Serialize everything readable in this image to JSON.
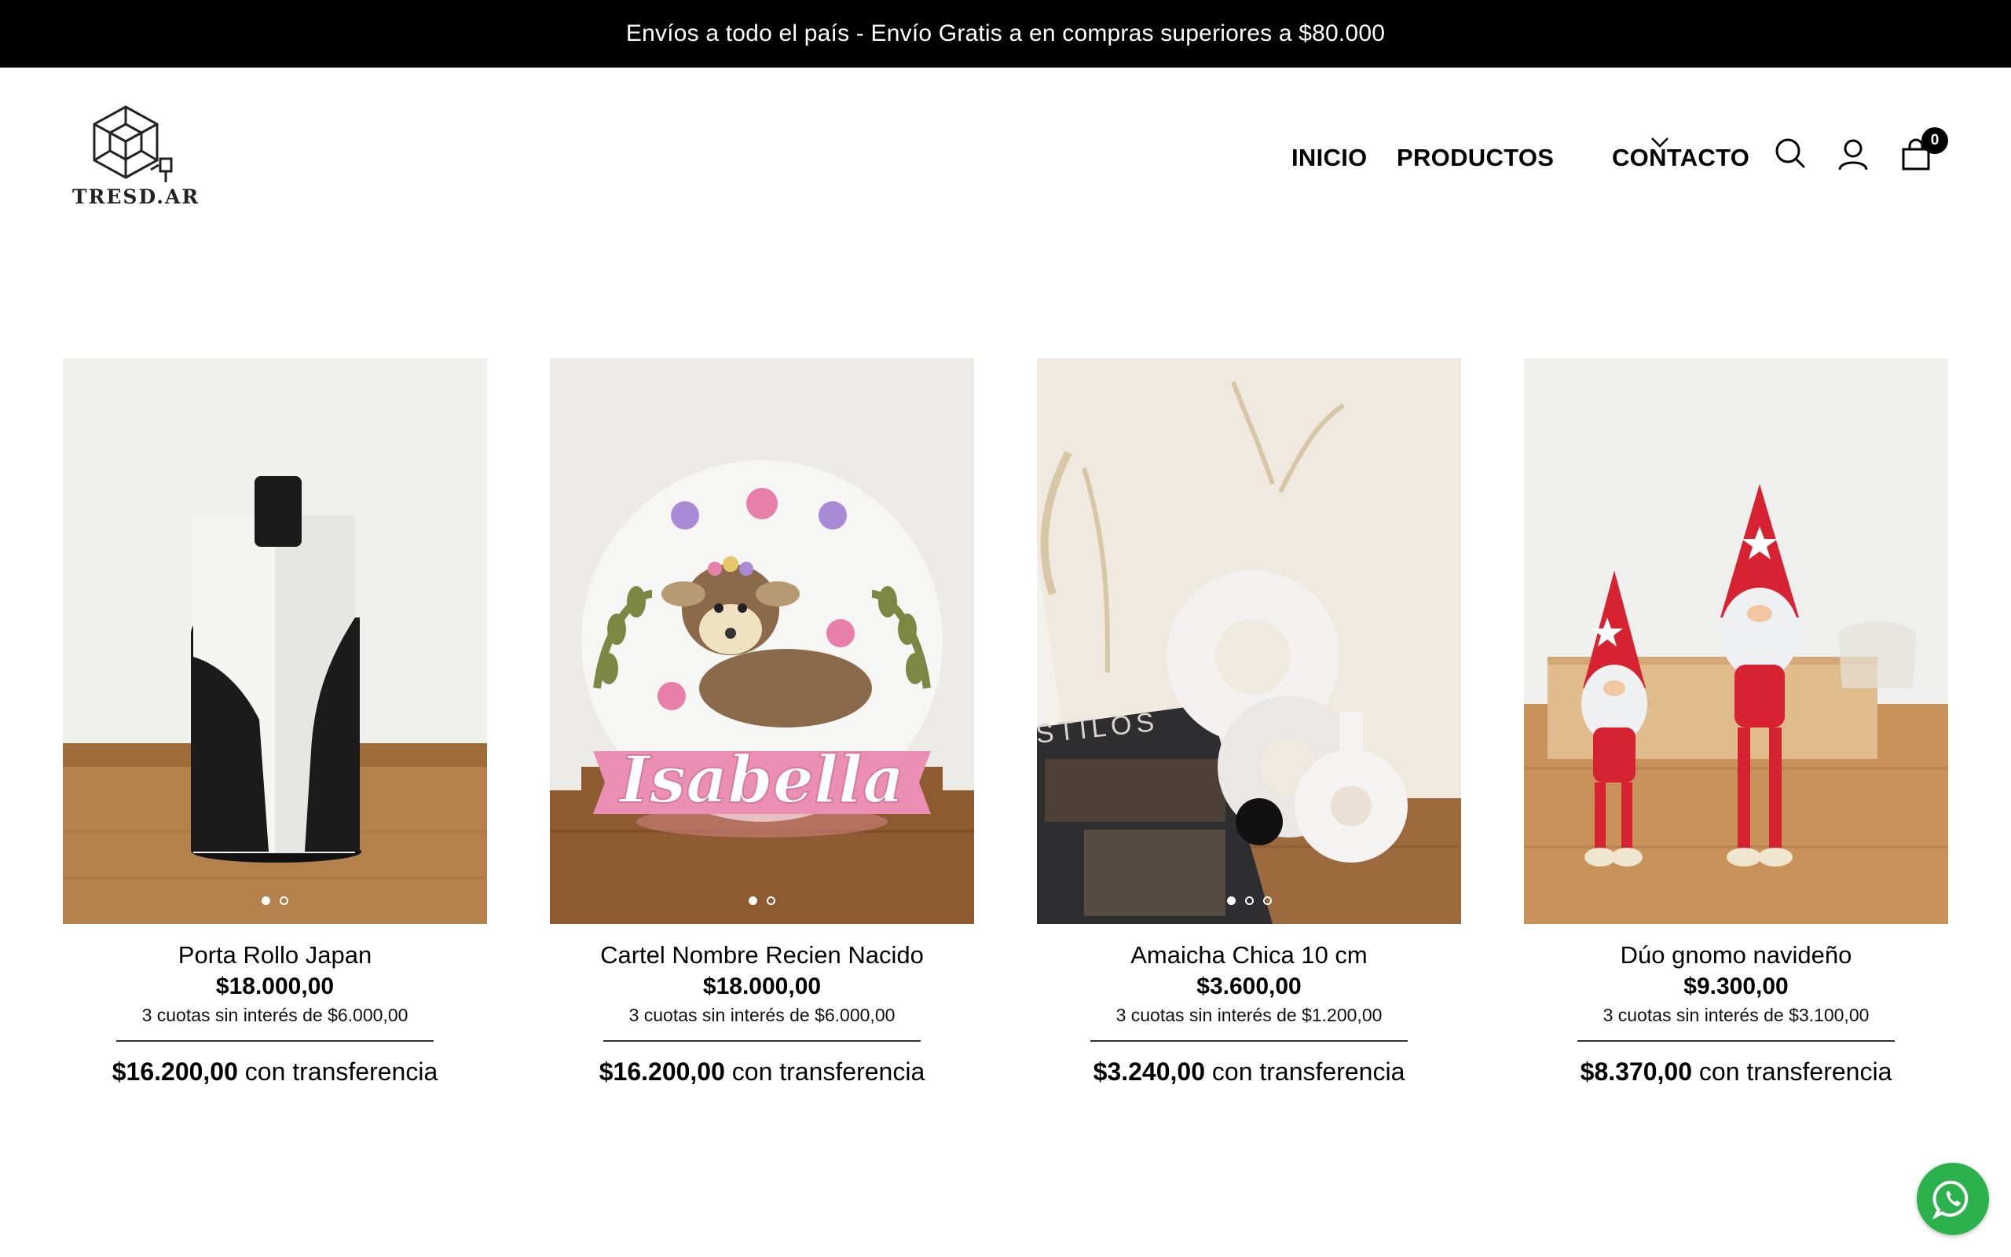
{
  "announcement": "Envíos a todo el país - Envío Gratis a en compras superiores a $80.000",
  "brand": {
    "logo_text": "TRESD.AR"
  },
  "nav": {
    "inicio": "INICIO",
    "productos": "PRODUCTOS",
    "contacto": "CONTACTO"
  },
  "cart": {
    "count": "0"
  },
  "products": [
    {
      "name": "Porta Rollo Japan",
      "price": "$18.000,00",
      "installments": "3 cuotas sin interés de $6.000,00",
      "transfer_price": "$16.200,00",
      "transfer_label": "con transferencia"
    },
    {
      "name": "Cartel Nombre Recien Nacido",
      "price": "$18.000,00",
      "installments": "3 cuotas sin interés de $6.000,00",
      "transfer_price": "$16.200,00",
      "transfer_label": "con transferencia",
      "image_text": "Isabella"
    },
    {
      "name": "Amaicha Chica 10 cm",
      "price": "$3.600,00",
      "installments": "3 cuotas sin interés de $1.200,00",
      "transfer_price": "$3.240,00",
      "transfer_label": "con transferencia",
      "image_text": "STILOS"
    },
    {
      "name": "Dúo gnomo navideño",
      "price": "$9.300,00",
      "installments": "3 cuotas sin interés de $3.100,00",
      "transfer_price": "$8.370,00",
      "transfer_label": "con transferencia"
    }
  ],
  "colors": {
    "topbar": "#000000",
    "whatsapp": "#2bb24c",
    "wood": "#b07a45",
    "wall": "#f1f1ef"
  }
}
